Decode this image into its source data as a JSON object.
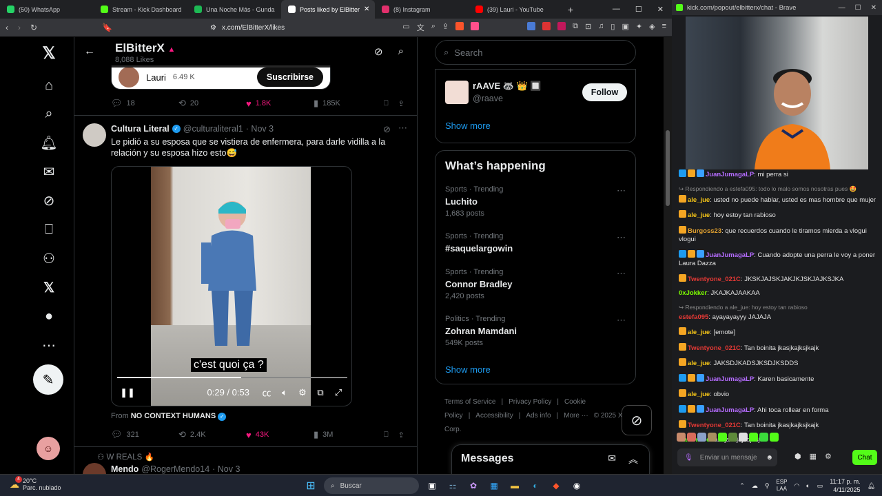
{
  "browser": {
    "tabs": [
      {
        "label": "(50) WhatsApp",
        "color": "#25d366"
      },
      {
        "label": "Stream - Kick Dashboard",
        "color": "#53fc18"
      },
      {
        "label": "Una Noche Más - Gunda",
        "color": "#1db954"
      },
      {
        "label": "Posts liked by ElBitter",
        "color": "#ffffff",
        "active": true
      },
      {
        "label": "(8) Instagram",
        "color": "#e1306c"
      },
      {
        "label": "(39) Lauri - YouTube",
        "color": "#ff0000"
      }
    ],
    "url": "x.com/ElBitterX/likes",
    "window_controls": [
      "—",
      "☐",
      "✕"
    ]
  },
  "profile": {
    "name": "ElBitterX",
    "likes_label": "8,088 Likes"
  },
  "top_card": {
    "author": "Lauri",
    "followers": "6.49 K",
    "subscribe_label": "Suscribirse"
  },
  "top_actions": {
    "replies": "18",
    "reposts": "20",
    "likes": "1.8K",
    "views": "185K"
  },
  "tweet": {
    "author": "Cultura Literal",
    "handle": "@culturaliteral1",
    "date": "· Nov 3",
    "text": "Le pidió a su esposa que se vistiera de enfermera, para darle vidilla a la relación y su esposa hizo esto😅",
    "subtitle": "c'est quoi ça ?",
    "time": "0:29 / 0:53",
    "progress": 0.54,
    "from_prefix": "From",
    "from_source": "NO CONTEXT HUMANS",
    "actions": {
      "replies": "321",
      "reposts": "2.4K",
      "likes": "43K",
      "views": "3M"
    }
  },
  "next_tweet": {
    "social_context": "W REALS 🔥",
    "author": "Mendo",
    "handle": "@RogerMendo14",
    "date": "· Nov 3"
  },
  "sidebar": {
    "search_placeholder": "Search",
    "suggestion": {
      "name": "rAAVE 🦝 👑 🔲",
      "handle": "@raave",
      "follow_label": "Follow"
    },
    "show_more": "Show more",
    "happening_title": "What’s happening",
    "trends": [
      {
        "category": "Sports · Trending",
        "name": "Luchito",
        "count": "1,683 posts"
      },
      {
        "category": "Sports · Trending",
        "name": "#saquelargowin",
        "count": ""
      },
      {
        "category": "Sports · Trending",
        "name": "Connor Bradley",
        "count": "2,420 posts"
      },
      {
        "category": "Politics · Trending",
        "name": "Zohran Mamdani",
        "count": "549K posts"
      }
    ],
    "show_more_2": "Show more",
    "footer_links": [
      "Terms of Service",
      "|",
      "Privacy Policy",
      "|",
      "Cookie Policy",
      "|",
      "Accessibility",
      "|",
      "Ads info",
      "|",
      "More ···",
      "© 2025 X Corp."
    ],
    "messages_title": "Messages"
  },
  "kick": {
    "title": "kick.com/popout/elbitterx/chat - Brave",
    "messages": [
      {
        "user": "JuanJumagaLP",
        "color": "#b56cff",
        "badges": [
          "#1d9bf0",
          "#f5a623",
          "#3aa0ff"
        ],
        "text": "mi perra si"
      },
      {
        "reply": "Respondiendo a estefa095: todo lo malo somos nosotras pues 🤩"
      },
      {
        "user": "ale_jue",
        "color": "#f5c518",
        "badges": [
          "#f5a623"
        ],
        "text": "usted no puede hablar, usted es mas hombre que mujer"
      },
      {
        "user": "ale_jue",
        "color": "#f5c518",
        "badges": [
          "#f5a623"
        ],
        "text": "hoy estoy tan rabioso"
      },
      {
        "user": "Burgoss23",
        "color": "#e0a030",
        "badges": [
          "#f5a623"
        ],
        "text": "que recuerdos cuando le tiramos mierda a vlogui vlogui"
      },
      {
        "user": "JuanJumagaLP",
        "color": "#b56cff",
        "badges": [
          "#1d9bf0",
          "#f5a623",
          "#3aa0ff"
        ],
        "text": "Cuando adopte una perra le voy a poner Laura Dazza"
      },
      {
        "user": "Twentyone_021C",
        "color": "#e53935",
        "badges": [
          "#f5a623"
        ],
        "text": "JKSKJAJSKJAKJKJSKJAJKSJKA"
      },
      {
        "user": "0xJokker",
        "color": "#7cfc00",
        "badges": [],
        "text": "JKAJKAJAAKAA"
      },
      {
        "reply": "Respondiendo a ale_jue: hoy estoy tan rabioso"
      },
      {
        "user": "estefa095",
        "color": "#e53935",
        "badges": [],
        "text": "ayayayayyy JAJAJA"
      },
      {
        "user": "ale_jue",
        "color": "#f5c518",
        "badges": [
          "#f5a623"
        ],
        "text": "[emote]"
      },
      {
        "user": "Twentyone_021C",
        "color": "#e53935",
        "badges": [
          "#f5a623"
        ],
        "text": "Tan boinita jkasjkajksjkajk"
      },
      {
        "user": "ale_jue",
        "color": "#f5c518",
        "badges": [
          "#f5a623"
        ],
        "text": "JAKSDJKADSJKSDJKSDDS"
      },
      {
        "user": "JuanJumagaLP",
        "color": "#b56cff",
        "badges": [
          "#1d9bf0",
          "#f5a623",
          "#3aa0ff"
        ],
        "text": "Karen basicamente"
      },
      {
        "user": "ale_jue",
        "color": "#f5c518",
        "badges": [
          "#f5a623"
        ],
        "text": "obvio"
      },
      {
        "user": "JuanJumagaLP",
        "color": "#b56cff",
        "badges": [
          "#1d9bf0",
          "#f5a623",
          "#3aa0ff"
        ],
        "text": "Ahi toca rollear en forma"
      },
      {
        "user": "Twentyone_021C",
        "color": "#e53935",
        "badges": [
          "#f5a623"
        ],
        "text": "Tan boinita jkasjkajksjkajk"
      },
      {
        "user": "KarennGo",
        "color": "#53fc18",
        "badges": [],
        "text": "asdjasdjajsdjasjd"
      }
    ],
    "input_placeholder": "Enviar un mensaje",
    "chat_button": "Chat"
  },
  "taskbar": {
    "temp": "20°C",
    "weather": "Parc. nublado",
    "search": "Buscar",
    "lang1": "ESP",
    "lang2": "LAA",
    "time": "11:17 p. m.",
    "date": "4/11/2025",
    "badge": "4"
  }
}
